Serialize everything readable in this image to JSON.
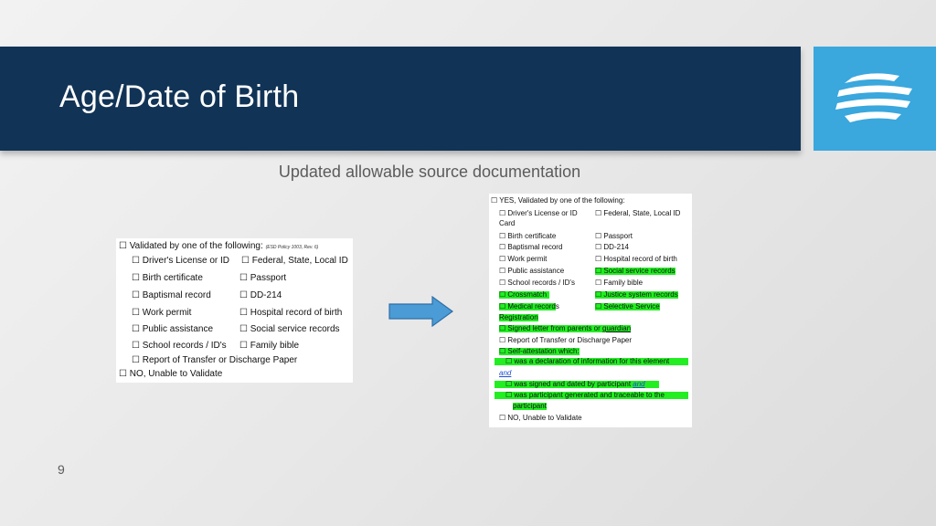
{
  "slide": {
    "title": "Age/Date of Birth",
    "subtitle": "Updated allowable source documentation",
    "page_number": "9"
  },
  "colors": {
    "title_bar": "#113356",
    "logo_bg": "#3aa7dd",
    "highlight": "#22ee22"
  },
  "icons": {
    "logo": "wave-lines-logo-icon",
    "arrow": "right-arrow-icon"
  },
  "left_doc": {
    "heading": "☐ Validated by one of the following:",
    "heading_note": "(ESD Policy 1003, Rev. 6)",
    "items": [
      "☐ Driver's License or ID",
      "☐ Federal, State, Local ID",
      "☐ Birth certificate",
      "☐ Passport",
      "☐ Baptismal record",
      "☐ DD-214",
      "☐ Work permit",
      "☐ Hospital record of birth",
      "☐ Public assistance",
      "☐ Social service records",
      "☐ School records / ID's",
      "☐ Family bible",
      "☐ Report of Transfer or Discharge Paper"
    ],
    "no_option": "☐ NO, Unable to Validate"
  },
  "right_doc": {
    "heading": "☐ YES, Validated by one of the following:",
    "items": [
      "☐ Driver's License or ID",
      "☐ Federal, State, Local ID",
      "Card",
      "☐ Birth certificate",
      "☐ Passport",
      "☐ Baptismal record",
      "☐ DD-214",
      "☐ Work permit",
      "☐ Hospital record of birth",
      "☐ Public assistance",
      "☐ Social service records",
      "☐ School records / ID's",
      "☐ Family bible",
      "☐ Crossmatch",
      "☐ Justice system records",
      "☐ Medical records",
      "☐ Selective Service",
      "Registration",
      "☐ Signed letter from parents or",
      "guardian",
      "☐ Report of Transfer or Discharge Paper",
      "☐ Self-attestation which:",
      "☐ was a declaration of information for this element",
      "and",
      "☐ was signed and dated by participant",
      "and",
      "☐ was participant generated and traceable to the",
      "participant"
    ],
    "no_option": "☐ NO, Unable to Validate"
  }
}
